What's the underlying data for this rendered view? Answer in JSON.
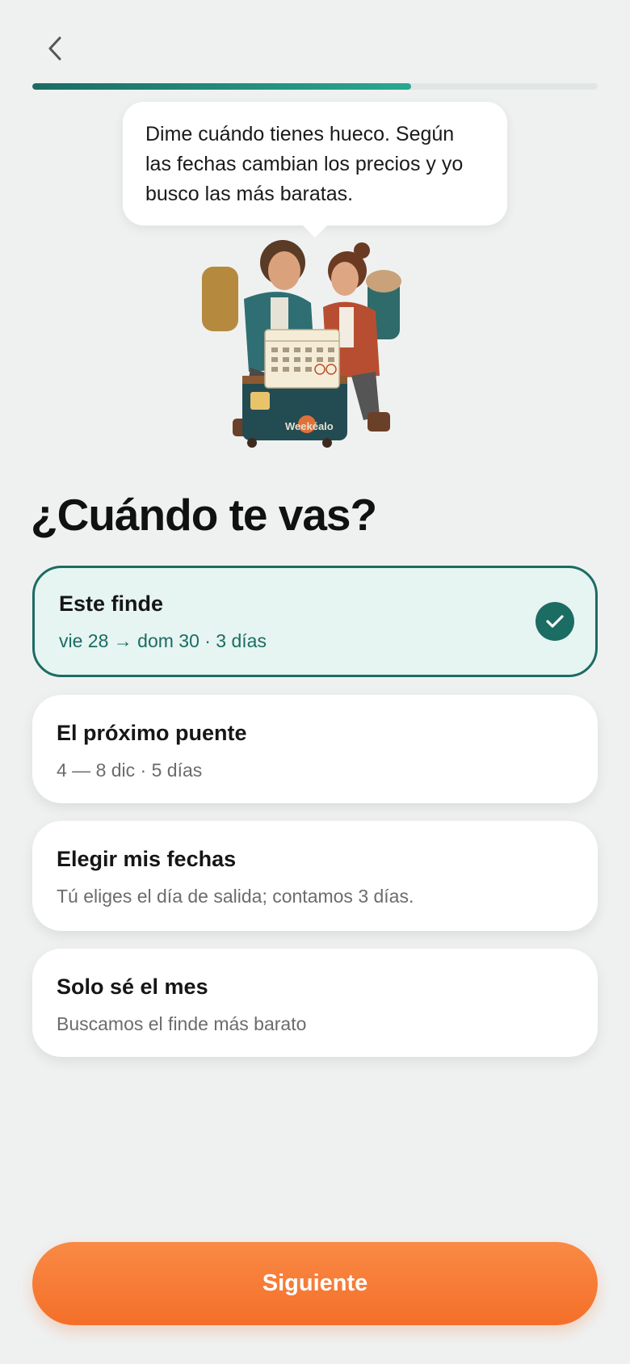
{
  "progress": {
    "fraction": 0.67
  },
  "bubble": {
    "text": "Dime cuándo tienes hueco. Según las fechas cambian los precios y yo busco las más baratas."
  },
  "illustration": {
    "brand_label": "Weekéalo"
  },
  "page": {
    "title": "¿Cuándo te vas?"
  },
  "options": [
    {
      "title": "Este finde",
      "subtitle": "vie 28 → dom 30 · 3 días",
      "selected": true
    },
    {
      "title": "El próximo puente",
      "subtitle": "4 — 8 dic · 5 días",
      "selected": false
    },
    {
      "title": "Elegir mis fechas",
      "subtitle": "Tú eliges el día de salida; contamos 3 días.",
      "selected": false
    },
    {
      "title": "Solo sé el mes",
      "subtitle": "Buscamos el finde más barato",
      "selected": false
    }
  ],
  "footer": {
    "next_label": "Siguiente"
  },
  "colors": {
    "accent": "#1b6c62",
    "cta": "#f46f29",
    "background": "#eff1f1"
  },
  "icons": {
    "back": "chevron-left-icon",
    "check": "check-icon"
  }
}
